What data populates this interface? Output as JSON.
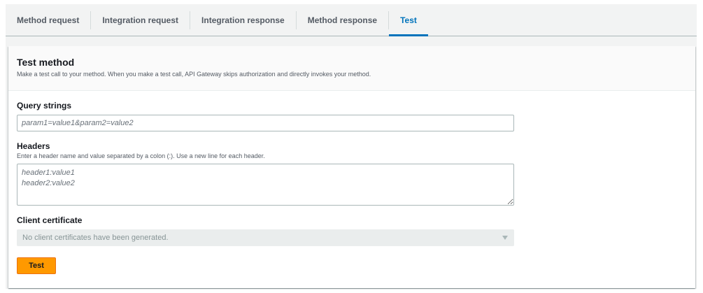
{
  "tabs": [
    {
      "label": "Method request",
      "active": false
    },
    {
      "label": "Integration request",
      "active": false
    },
    {
      "label": "Integration response",
      "active": false
    },
    {
      "label": "Method response",
      "active": false
    },
    {
      "label": "Test",
      "active": true
    }
  ],
  "panel": {
    "title": "Test method",
    "description": "Make a test call to your method. When you make a test call, API Gateway skips authorization and directly invokes your method."
  },
  "query_strings": {
    "label": "Query strings",
    "placeholder": "param1=value1&param2=value2",
    "value": ""
  },
  "headers": {
    "label": "Headers",
    "hint": "Enter a header name and value separated by a colon (:). Use a new line for each header.",
    "placeholder": "header1:value1\nheader2:value2",
    "value": ""
  },
  "client_certificate": {
    "label": "Client certificate",
    "selected": "No client certificates have been generated.",
    "disabled": true
  },
  "test_button": {
    "label": "Test"
  },
  "colors": {
    "accent": "#0073bb",
    "primary_button": "#ff9900"
  }
}
